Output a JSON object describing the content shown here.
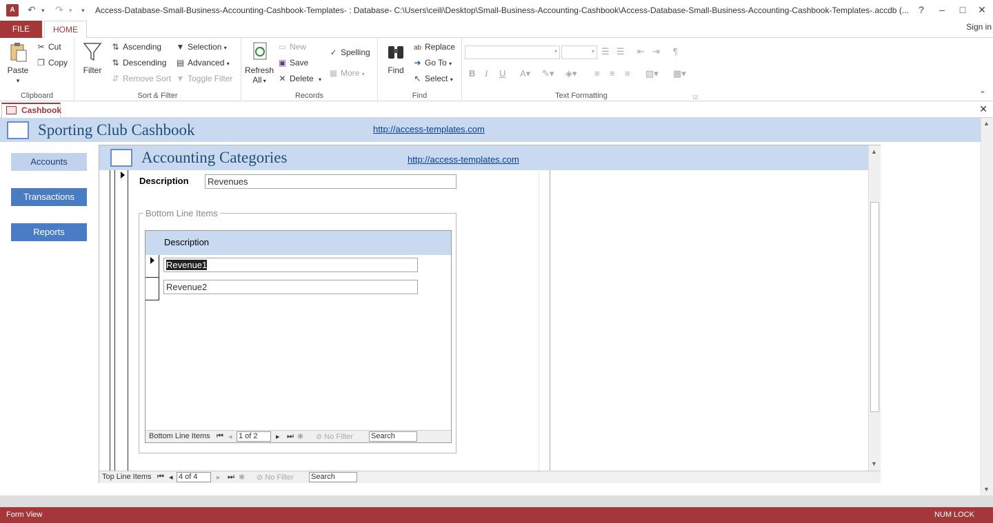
{
  "window": {
    "title": "Access-Database-Small-Business-Accounting-Cashbook-Templates- : Database- C:\\Users\\ceili\\Desktop\\Small-Business-Accounting-Cashbook\\Access-Database-Small-Business-Accounting-Cashbook-Templates-.accdb (...",
    "app_icon": "A",
    "help": "?",
    "minimize": "–",
    "maximize": "□",
    "close": "✕"
  },
  "tabs": {
    "file": "FILE",
    "home": "HOME",
    "sign_in": "Sign in"
  },
  "ribbon": {
    "clipboard": {
      "label": "Clipboard",
      "paste": "Paste",
      "cut": "Cut",
      "copy": "Copy"
    },
    "sort_filter": {
      "label": "Sort & Filter",
      "filter": "Filter",
      "ascending": "Ascending",
      "descending": "Descending",
      "remove_sort": "Remove Sort",
      "selection": "Selection",
      "advanced": "Advanced",
      "toggle_filter": "Toggle Filter"
    },
    "records": {
      "label": "Records",
      "refresh_all": "Refresh",
      "refresh_all_2": "All",
      "new": "New",
      "save": "Save",
      "delete": "Delete",
      "spelling": "Spelling",
      "more": "More"
    },
    "find": {
      "label": "Find",
      "find": "Find",
      "replace": "Replace",
      "go_to": "Go To",
      "select": "Select"
    },
    "text_formatting": {
      "label": "Text Formatting",
      "bold": "B",
      "italic": "I",
      "underline": "U"
    }
  },
  "document": {
    "tab_label": "Cashbook",
    "close": "✕"
  },
  "main": {
    "title": "Sporting Club Cashbook",
    "link": "http://access-templates.com",
    "nav": [
      {
        "label": "Accounts"
      },
      {
        "label": "Transactions"
      },
      {
        "label": "Reports"
      }
    ]
  },
  "sub": {
    "title": "Accounting Categories",
    "link": "http://access-templates.com",
    "description_label": "Description",
    "description_value": "Revenues",
    "group_label": "Bottom Line Items",
    "inner_header": "Description",
    "rows": [
      "Revenue1",
      "Revenue2"
    ],
    "inner_nav": {
      "label": "Bottom Line Items",
      "position": "1 of 2",
      "no_filter": "No Filter",
      "search": "Search"
    },
    "outer_nav": {
      "label": "Top Line Items",
      "position": "4 of 4",
      "no_filter": "No Filter",
      "search": "Search"
    }
  },
  "status": {
    "left": "Form View",
    "right": "NUM LOCK"
  },
  "colors": {
    "accent": "#a4373a",
    "header": "#c9d9ef",
    "nav_button": "#4a7cc6",
    "nav_selected": "#c0d2ec"
  }
}
